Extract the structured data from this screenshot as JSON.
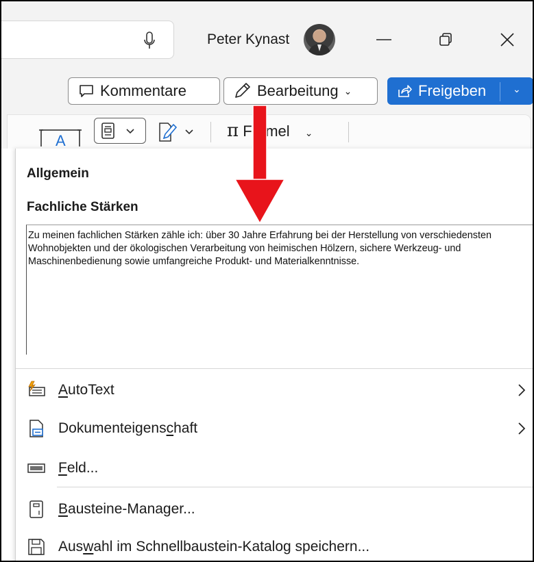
{
  "window": {
    "user_name": "Peter Kynast",
    "search_icon": "microphone-icon",
    "controls": {
      "minimize": "minimize-icon",
      "restore": "restore-icon",
      "close": "close-icon"
    }
  },
  "command_bar": {
    "comments_label": "Kommentare",
    "editing_label": "Bearbeitung",
    "share_label": "Freigeben",
    "share_color": "#1f6fd1"
  },
  "ribbon": {
    "formula_label": "Formel",
    "items": [
      "text-box-icon",
      "quick-parts-icon",
      "signature-line-icon",
      "equation-icon"
    ]
  },
  "panel": {
    "section_general": "Allgemein",
    "section_strengths": "Fachliche Stärken",
    "gallery_text": "Zu meinen fachlichen Stärken zähle ich: über 30 Jahre Erfahrung bei der Herstellung von verschiedensten Wohnobjekten und der ökologischen Verarbeitung von heimischen Hölzern, sichere Werkzeug- und Maschinenbedienung sowie umfangreiche Produkt- und Materialkenntnisse.",
    "menu": {
      "autotext": {
        "pre": "",
        "key": "A",
        "post": "utoText"
      },
      "docprop": {
        "pre": "Dokumenteigens",
        "key": "c",
        "post": "haft"
      },
      "field": {
        "pre": "",
        "key": "F",
        "post": "eld..."
      },
      "manager": {
        "pre": "",
        "key": "B",
        "post": "austeine-Manager..."
      },
      "save": {
        "pre": "Aus",
        "key": "w",
        "post": "ahl im Schnellbaustein-Katalog speichern..."
      }
    }
  },
  "annotation": {
    "arrow_color": "#e8141b"
  }
}
